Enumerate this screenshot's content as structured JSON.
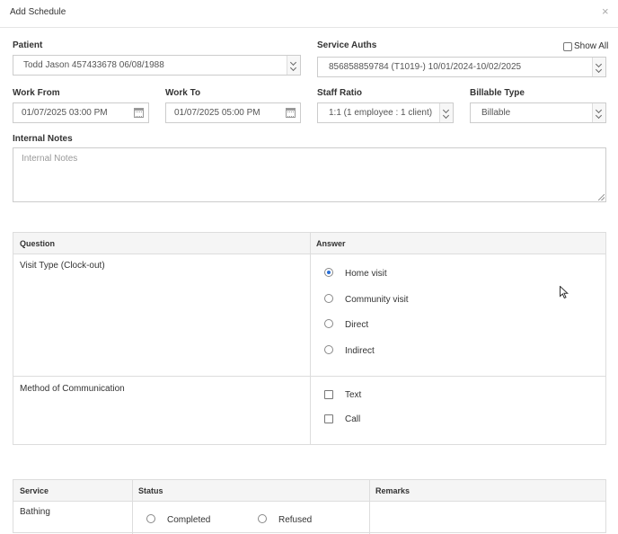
{
  "modal": {
    "title": "Add Schedule",
    "close": "×"
  },
  "form": {
    "patient": {
      "label": "Patient",
      "value": "Todd Jason 457433678 06/08/1988"
    },
    "service_auths": {
      "label": "Service Auths",
      "value": "856858859784 (T1019-) 10/01/2024-10/02/2025",
      "show_all": "Show All"
    },
    "work_from": {
      "label": "Work From",
      "value": "01/07/2025 03:00 PM"
    },
    "work_to": {
      "label": "Work To",
      "value": "01/07/2025 05:00 PM"
    },
    "staff_ratio": {
      "label": "Staff Ratio",
      "value": "1:1 (1 employee : 1 client)"
    },
    "billable_type": {
      "label": "Billable Type",
      "value": "Billable"
    },
    "internal_notes": {
      "label": "Internal Notes",
      "placeholder": "Internal Notes"
    }
  },
  "questions": {
    "headers": {
      "question": "Question",
      "answer": "Answer"
    },
    "visit_type": {
      "question": "Visit Type (Clock-out)",
      "options": [
        "Home visit",
        "Community visit",
        "Direct",
        "Indirect"
      ],
      "selected": "Home visit"
    },
    "communication": {
      "question": "Method of Communication",
      "options": [
        "Text",
        "Call"
      ]
    }
  },
  "services": {
    "headers": {
      "service": "Service",
      "status": "Status",
      "remarks": "Remarks"
    },
    "rows": [
      {
        "service": "Bathing",
        "status_options": [
          "Completed",
          "Refused"
        ]
      }
    ]
  },
  "colors": {
    "accent": "#2a6fd6",
    "border": "#cccccc",
    "header_bg": "#f5f5f5"
  }
}
